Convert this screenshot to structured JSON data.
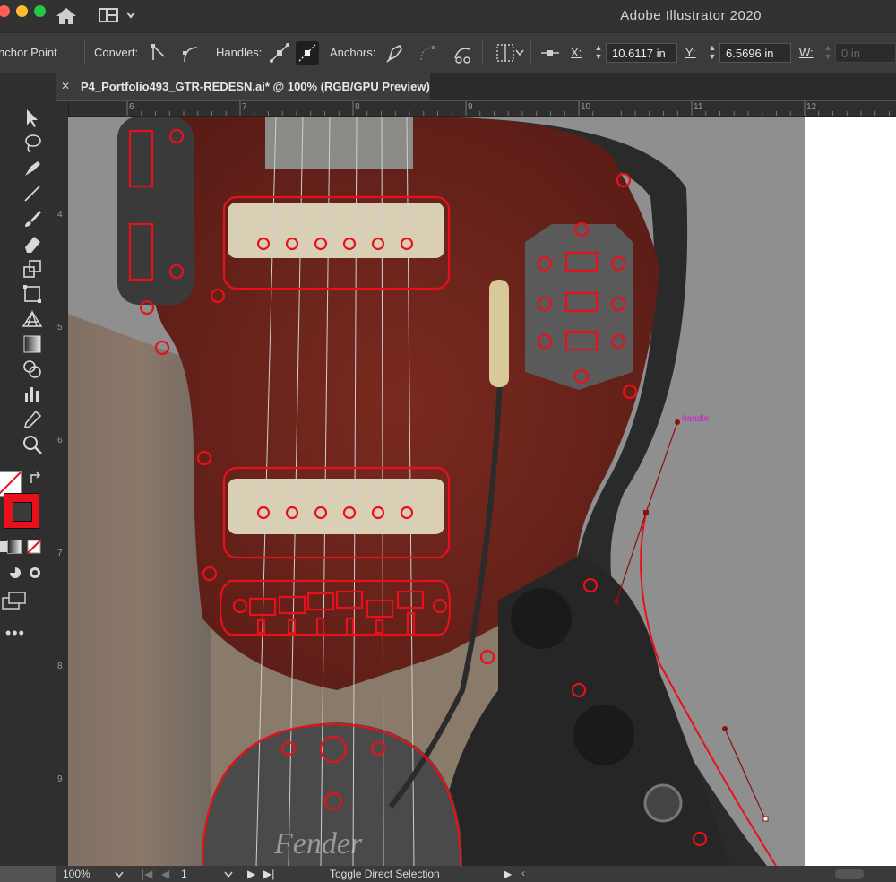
{
  "window": {
    "app_title": "Adobe Illustrator 2020"
  },
  "control_bar": {
    "tool_name": "nchor Point",
    "convert_label": "Convert:",
    "handles_label": "Handles:",
    "anchors_label": "Anchors:",
    "x_label": "X:",
    "x_value": "10.6117 in",
    "y_label": "Y:",
    "y_value": "6.5696 in",
    "w_label": "W:",
    "w_value": "0 in"
  },
  "document": {
    "tab_title": "P4_Portfolio493_GTR-REDESN.ai* @ 100% (RGB/GPU Preview)",
    "close_symbol": "✕"
  },
  "rulers": {
    "top_ticks": [
      "6",
      "7",
      "8",
      "9",
      "10",
      "11",
      "12"
    ],
    "left_ticks": [
      "4",
      "5",
      "6",
      "7",
      "8",
      "9"
    ]
  },
  "artwork": {
    "handle_label": "handle",
    "brand_text": "Fender",
    "accent_red": "#e8101a",
    "handle_magenta": "#d21ad6"
  },
  "status_bar": {
    "zoom": "100%",
    "artboard_number": "1",
    "current_tool": "Toggle Direct Selection"
  }
}
